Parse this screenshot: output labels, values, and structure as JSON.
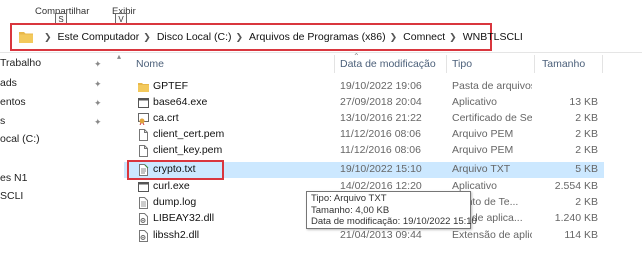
{
  "ribbon": {
    "share_label": "Compartilhar",
    "share_keytip": "S",
    "view_label": "Exibir",
    "view_keytip": "V"
  },
  "address_bar": {
    "crumbs": [
      "Este Computador",
      "Disco Local (C:)",
      "Arquivos de Programas (x86)",
      "Comnect",
      "WNBTLSCLI"
    ],
    "highlight_color": "#d9363e"
  },
  "nav_pane": {
    "items": [
      "Trabalho",
      "ads",
      "entos",
      "s",
      "ocal (C:)",
      "es N1",
      "SCLI"
    ]
  },
  "columns": {
    "name": "Nome",
    "date": "Data de modificação",
    "type": "Tipo",
    "size": "Tamanho"
  },
  "files": [
    {
      "name": "GPTEF",
      "date": "19/10/2022 19:06",
      "type": "Pasta de arquivos",
      "size": "",
      "icon": "folder-icon"
    },
    {
      "name": "base64.exe",
      "date": "27/09/2018 20:04",
      "type": "Aplicativo",
      "size": "13 KB",
      "icon": "exe-icon"
    },
    {
      "name": "ca.crt",
      "date": "13/10/2016 21:22",
      "type": "Certificado de Seg...",
      "size": "2 KB",
      "icon": "certificate-icon"
    },
    {
      "name": "client_cert.pem",
      "date": "11/12/2016 08:06",
      "type": "Arquivo PEM",
      "size": "2 KB",
      "icon": "file-icon"
    },
    {
      "name": "client_key.pem",
      "date": "11/12/2016 08:06",
      "type": "Arquivo PEM",
      "size": "2 KB",
      "icon": "file-icon"
    },
    {
      "name": "crypto.txt",
      "date": "19/10/2022 15:10",
      "type": "Arquivo TXT",
      "size": "5 KB",
      "icon": "text-file-icon"
    },
    {
      "name": "curl.exe",
      "date": "14/02/2016 12:20",
      "type": "Aplicativo",
      "size": "2.554 KB",
      "icon": "exe-icon"
    },
    {
      "name": "dump.log",
      "date": "",
      "type": "mento de Te...",
      "size": "2 KB",
      "icon": "log-file-icon"
    },
    {
      "name": "LIBEAY32.dll",
      "date": "",
      "type": "são de aplica...",
      "size": "1.240 KB",
      "icon": "dll-icon"
    },
    {
      "name": "libssh2.dll",
      "date": "21/04/2013 09:44",
      "type": "Extensão de aplica...",
      "size": "114 KB",
      "icon": "dll-icon"
    }
  ],
  "selected_index": 5,
  "tooltip": {
    "type_line": "Tipo: Arquivo TXT",
    "size_line": "Tamanho: 4,00 KB",
    "date_line": "Data de modificação: 19/10/2022 15:10"
  },
  "colors": {
    "selection": "#cce8ff",
    "header_text": "#4c607a",
    "folder": "#e8b84a"
  }
}
